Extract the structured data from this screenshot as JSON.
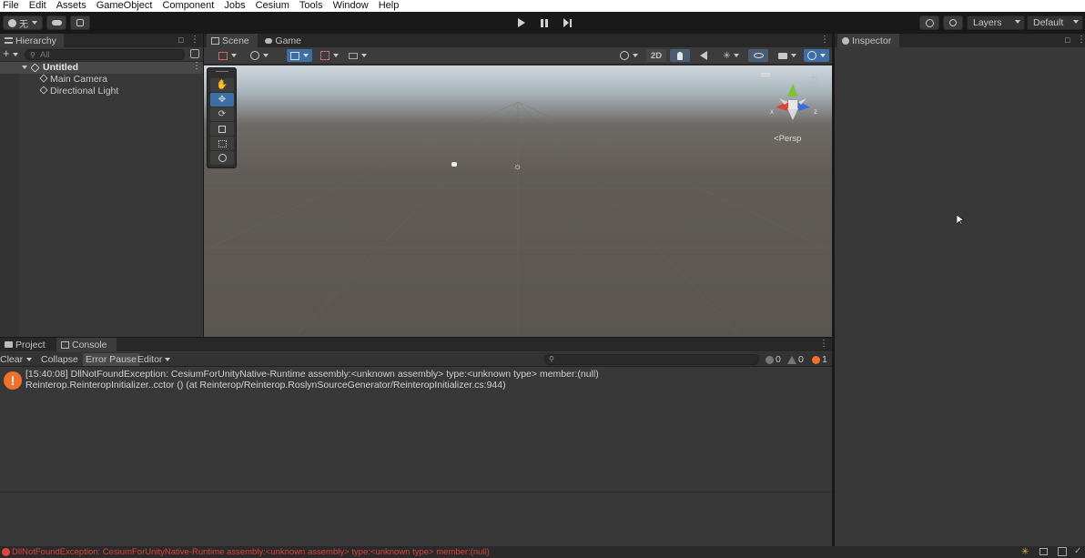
{
  "menu": [
    "File",
    "Edit",
    "Assets",
    "GameObject",
    "Component",
    "Jobs",
    "Cesium",
    "Tools",
    "Window",
    "Help"
  ],
  "toolbar": {
    "account_label": "无",
    "layers_label": "Layers",
    "layout_label": "Default"
  },
  "hierarchy": {
    "tab_label": "Hierarchy",
    "search_placeholder": "All",
    "scene_name": "Untitled",
    "items": [
      "Main Camera",
      "Directional Light"
    ]
  },
  "scene_panel": {
    "tabs": [
      "Scene",
      "Game"
    ],
    "mode_2d": "2D",
    "persp_label": "Persp",
    "gizmo_axes": {
      "x": "x",
      "z": "z"
    }
  },
  "inspector": {
    "tab_label": "Inspector"
  },
  "bottom_panel": {
    "tabs": [
      "Project",
      "Console"
    ],
    "buttons": [
      "Clear",
      "Collapse",
      "Error Pause",
      "Editor"
    ],
    "counts": {
      "log": "0",
      "warn": "0",
      "error": "1"
    },
    "log_entries": [
      {
        "line1": "[15:40:08] DllNotFoundException: CesiumForUnityNative-Runtime assembly:<unknown assembly> type:<unknown type> member:(null)",
        "line2": "Reinterop.ReinteropInitializer..cctor () (at Reinterop/Reinterop.RoslynSourceGenerator/ReinteropInitializer.cs:944)"
      }
    ]
  },
  "status_bar": {
    "message": "DllNotFoundException: CesiumForUnityNative-Runtime assembly:<unknown assembly> type:<unknown type> member:(null)",
    "error_color": "#e0443a"
  },
  "colors": {
    "accent": "#3d6fa6",
    "error_icon": "#f0712c"
  }
}
